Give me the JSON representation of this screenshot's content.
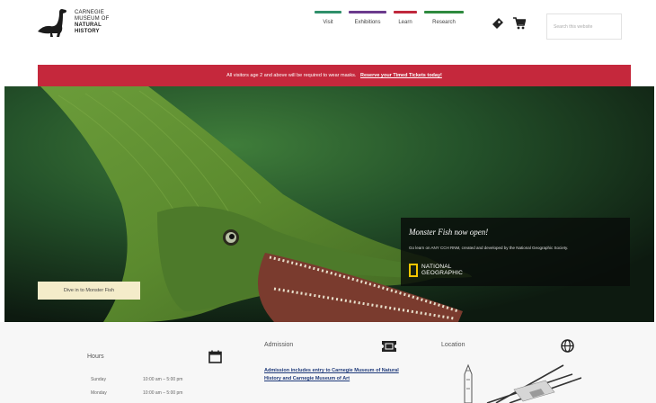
{
  "header": {
    "logo": {
      "line1": "CARNEGIE",
      "line2": "MUSEUM OF",
      "line3": "NATURAL",
      "line4": "HISTORY"
    },
    "nav": [
      {
        "label": "Visit",
        "color": "#2f8f6a"
      },
      {
        "label": "Exhibitions",
        "color": "#6b3a8c"
      },
      {
        "label": "Learn",
        "color": "#c0283c"
      },
      {
        "label": "Research",
        "color": "#2e8a3e"
      }
    ],
    "search_placeholder": "Search this website"
  },
  "alert": {
    "text": "All visitors age 2 and above will be required to wear masks.",
    "link": "Reserve your Timed Tickets today!",
    "color": "#c5283c"
  },
  "hero": {
    "button_label": "Dive in to Monster Fish",
    "promo": {
      "title": "Monster Fish now open!",
      "description": "Go learn on ANY CCH RNM, created and developed by the National Geographic Society.",
      "brand_line1": "NATIONAL",
      "brand_line2": "GEOGRAPHIC"
    }
  },
  "info": {
    "hours": {
      "title": "Hours",
      "rows": [
        {
          "day": "Sunday",
          "time": "10:00 am – 5:00 pm"
        },
        {
          "day": "Monday",
          "time": "10:00 am – 5:00 pm"
        }
      ]
    },
    "admission": {
      "title": "Admission",
      "link": "Admission includes entry to Carnegie Museum of Natural History and Carnegie Museum of Art"
    },
    "location": {
      "title": "Location"
    }
  }
}
